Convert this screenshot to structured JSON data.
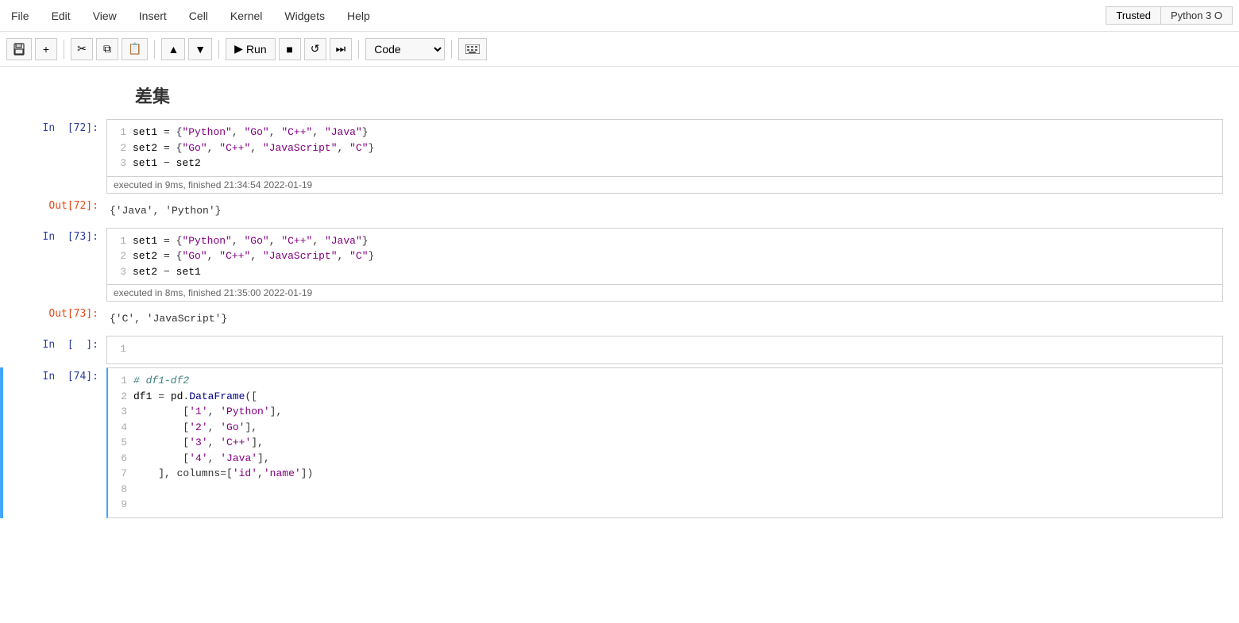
{
  "menubar": {
    "items": [
      "File",
      "Edit",
      "View",
      "Insert",
      "Cell",
      "Kernel",
      "Widgets",
      "Help"
    ]
  },
  "toolbar": {
    "save_label": "💾",
    "add_label": "+",
    "cut_label": "✂",
    "copy_label": "⧉",
    "paste_label": "📋",
    "move_up_label": "▲",
    "move_down_label": "▼",
    "run_label": "Run",
    "stop_label": "■",
    "restart_label": "↺",
    "restart_run_label": "⏭",
    "cell_type": "Code",
    "keyboard_label": "⌨"
  },
  "topbar": {
    "trusted": "Trusted",
    "kernel": "Python 3 O"
  },
  "heading": "差集",
  "cells": [
    {
      "id": "cell-72-in",
      "label": "In  [72]:",
      "type": "input",
      "lines": [
        {
          "num": "1",
          "code": "set1 = {“Python”, “Go”, “C++”, “Java”}"
        },
        {
          "num": "2",
          "code": "set2 = {“Go”, “C++”, “JavaScript”, “C”}"
        },
        {
          "num": "3",
          "code": "set1 − set2"
        }
      ],
      "executed": "executed in 9ms, finished 21:34:54 2022-01-19"
    },
    {
      "id": "cell-72-out",
      "label": "Out[72]:",
      "type": "output",
      "text": "{'Java', 'Python'}"
    },
    {
      "id": "cell-73-in",
      "label": "In  [73]:",
      "type": "input",
      "lines": [
        {
          "num": "1",
          "code": "set1 = {“Python”, “Go”, “C++”, “Java”}"
        },
        {
          "num": "2",
          "code": "set2 = {“Go”, “C++”, “JavaScript”, “C”}"
        },
        {
          "num": "3",
          "code": "set2 − set1"
        }
      ],
      "executed": "executed in 8ms, finished 21:35:00 2022-01-19"
    },
    {
      "id": "cell-73-out",
      "label": "Out[73]:",
      "type": "output",
      "text": "{'C',  'JavaScript'}"
    },
    {
      "id": "cell-empty",
      "label": "In  [  ]:",
      "type": "empty",
      "lines": [
        {
          "num": "1",
          "code": ""
        }
      ]
    },
    {
      "id": "cell-74-in",
      "label": "In  [74]:",
      "type": "input",
      "active": true,
      "lines": [
        {
          "num": "1",
          "code": "# df1-df2"
        },
        {
          "num": "2",
          "code": "df1 = pd.DataFrame(["
        },
        {
          "num": "3",
          "code": "        ['1', 'Python'],"
        },
        {
          "num": "4",
          "code": "        ['2', 'Go'],"
        },
        {
          "num": "5",
          "code": "        ['3', 'C++'],"
        },
        {
          "num": "6",
          "code": "        ['4', 'Java'],"
        },
        {
          "num": "7",
          "code": "    ], columns=['id','name'])"
        },
        {
          "num": "8",
          "code": ""
        },
        {
          "num": "9",
          "code": ""
        }
      ]
    }
  ]
}
